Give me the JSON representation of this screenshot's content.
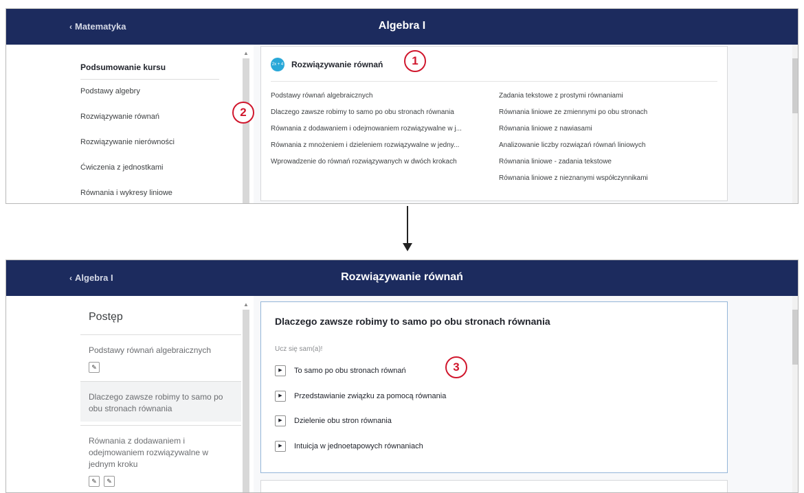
{
  "top": {
    "back_label": "Matematyka",
    "title": "Algebra I",
    "sidebar": [
      "Podsumowanie kursu",
      "Podstawy algebry",
      "Rozwiązywanie równań",
      "Rozwiązywanie nierówności",
      "Ćwiczenia z jednostkami",
      "Równania i wykresy liniowe"
    ],
    "unit_icon_text": "2x + 4",
    "unit_title": "Rozwiązywanie równań",
    "lessons_col1": [
      "Podstawy równań algebraicznych",
      "Dlaczego zawsze robimy to samo po obu stronach równania",
      "Równania z dodawaniem i odejmowaniem rozwiązywalne w j...",
      "Równania z mnożeniem i dzieleniem rozwiązywalne w jedny...",
      "Wprowadzenie do równań rozwiązywanych w dwóch krokach"
    ],
    "lessons_col2": [
      "Zadania tekstowe z prostymi równaniami",
      "Równania liniowe ze zmiennymi po obu stronach",
      "Równania liniowe z nawiasami",
      "Analizowanie liczby rozwiązań równań liniowych",
      "Równania liniowe - zadania tekstowe",
      "Równania liniowe z nieznanymi współczynnikami"
    ]
  },
  "callouts": [
    "1",
    "2",
    "3"
  ],
  "bottom": {
    "back_label": "Algebra I",
    "title": "Rozwiązywanie równań",
    "progress_title": "Postęp",
    "progress_items": [
      "Podstawy równań algebraicznych",
      "Dlaczego zawsze robimy to samo po obu stronach równania",
      "Równania z dodawaniem i odejmowaniem rozwiązywalne w jednym kroku"
    ],
    "card_title": "Dlaczego zawsze robimy to samo po obu stronach równania",
    "card_subtitle": "Ucz się sam(a)!",
    "videos": [
      "To samo po obu stronach równań",
      "Przedstawianie związku za pomocą równania",
      "Dzielenie obu stron równania",
      "Intuicja w jednoetapowych równaniach"
    ]
  },
  "colors": {
    "topbar": "#1c2b5e",
    "callout": "#d0162c",
    "unit_icon": "#29a8d8",
    "active_card_border": "#93b5d8"
  },
  "icons": {
    "back": "chevron-left-icon",
    "play": "play-icon",
    "pencil": "pencil-icon",
    "arrow": "arrow-down-icon"
  }
}
